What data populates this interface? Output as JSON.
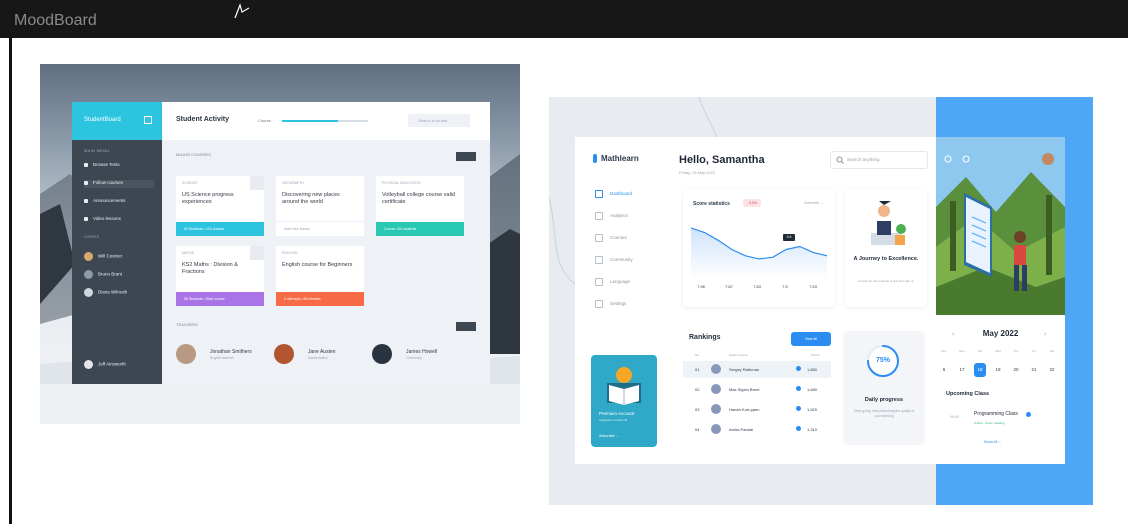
{
  "window": {
    "title": "MoodBoard"
  },
  "board1": {
    "sidebar": {
      "logo": "StudentBoard",
      "menu_label": "MAIN MENU",
      "items": [
        "Browse Tests",
        "Follow courses",
        "Announcements",
        "Video lessons"
      ],
      "users_label": "USERS",
      "users": [
        "Will Costner",
        "Bruno Brant",
        "Diana Wilmoth"
      ],
      "footer_user": "Jeff Ainsworth"
    },
    "header": {
      "title": "Student Activity",
      "progress_label": "Course",
      "progress": 0.65,
      "search_placeholder": "Search a course"
    },
    "section_courses": "MAJOR COURSES",
    "cards": [
      {
        "category": "SCIENCE",
        "title": "US Science progress experiences",
        "action": "59 Students   •  120 classes",
        "color": "#2cc4df"
      },
      {
        "category": "GEOGRAPHY",
        "title": "Discovering new places around the world",
        "action": "Start new lesson",
        "color": "#ffffff"
      },
      {
        "category": "PHYSICAL EDUCATION",
        "title": "Volleyball college course valid certificate",
        "action": "Course 120 students",
        "color": "#28c8b4"
      },
      {
        "category": "MATHS",
        "title": "KS2 Maths : Division & Fractions",
        "action": "58 Students  •  Start course",
        "color": "#a874e6"
      },
      {
        "category": "ENGLISH",
        "title": "English course for Beginners",
        "action": "2 attempts   •  85 minutes",
        "color": "#f66b45"
      }
    ],
    "section_teachers": "TEACHERS",
    "teachers": [
      {
        "name": "Jonathan Smithers",
        "subject": "English teacher"
      },
      {
        "name": "Jane Austen",
        "subject": "Mathematics"
      },
      {
        "name": "James Howell",
        "subject": "Chemistry"
      }
    ]
  },
  "board2": {
    "logo": "Mathlearn",
    "nav": [
      "Dashboard",
      "Analytics",
      "Courses",
      "Community",
      "Language",
      "Settings"
    ],
    "greeting": "Hello, Samantha",
    "date": "Friday, 13 May 2022",
    "search_placeholder": "Search anything",
    "score": {
      "title": "Score statistics",
      "badge": "- 5.5%",
      "dropdown": "Semester",
      "tooltip": "5.6",
      "xvals": [
        "7.96",
        "7.87",
        "7.83",
        "7.5",
        "7.53"
      ],
      "series": [
        6.8,
        6.5,
        6.0,
        5.4,
        5.0,
        4.8,
        4.9,
        5.4,
        5.6,
        5.2,
        5.0
      ]
    },
    "journey": {
      "title": "A Journey to Excellence.",
      "subtitle": "Unlock the full potential of learning with us"
    },
    "rankings": {
      "title": "Rankings",
      "view_all": "View All",
      "headers": [
        "No.",
        "Student Name",
        "Points"
      ],
      "rows": [
        {
          "no": "01",
          "name": "Sergey Rathman",
          "points": "1,880"
        },
        {
          "no": "02",
          "name": "Max Sigelo Brent",
          "points": "1,680"
        },
        {
          "no": "03",
          "name": "Hanah Kurt-ppen",
          "points": "1,520"
        },
        {
          "no": "04",
          "name": "Amira Pandai",
          "points": "1,310"
        }
      ]
    },
    "premium": {
      "title": "Premium Account",
      "subtitle": "Upgrade to unlock all",
      "cta": "Subscribe"
    },
    "daily": {
      "percent": "75%",
      "value": 0.75,
      "title": "Daily progress",
      "text": "Keep going, keep improving the quality of your learning"
    },
    "calendar": {
      "month": "May 2022",
      "days": [
        "Sun",
        "Mon",
        "Tue",
        "Wed",
        "Thu",
        "Fri",
        "Sat"
      ],
      "dates": [
        "6",
        "17",
        "18",
        "19",
        "20",
        "21",
        "22"
      ],
      "selected_index": 2
    },
    "upcoming": {
      "title": "Upcoming Class",
      "time": "09:00",
      "class": "Programming Class",
      "sub": "Online · Zoom meeting",
      "more": "Show All"
    }
  },
  "colors": {
    "accent_cyan": "#2cc4df",
    "brand_blue": "#2b8df2",
    "board_blue": "#4ea6f6",
    "sidebar_dark": "#3d4752"
  }
}
